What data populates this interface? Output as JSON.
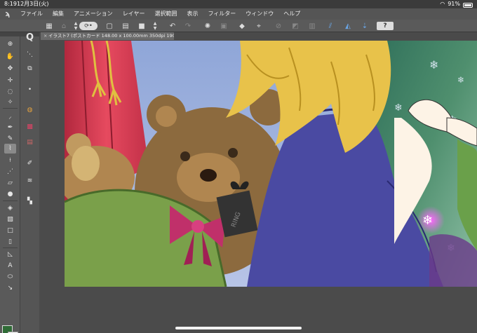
{
  "status_bar": {
    "time": "8:19",
    "date": "12月3日(火)",
    "battery": "91%"
  },
  "menu": {
    "items": [
      "ファイル",
      "編集",
      "アニメーション",
      "レイヤー",
      "選択範囲",
      "表示",
      "フィルター",
      "ウィンドウ",
      "ヘルプ"
    ]
  },
  "toolbar": {
    "help_label": "?",
    "zoom_icon": "zoom-icon"
  },
  "document": {
    "tab_title": "イラスト7 (ポストカード 148.00 x 100.00mm 350dpi 190.2%)"
  },
  "colors": {
    "foreground": "#2f6b36",
    "background": "#ffffff",
    "accent": "#6aa7e8"
  },
  "tools_left": [
    "magnifier-icon",
    "hand-icon",
    "move-icon",
    "transform-icon",
    "lasso-icon",
    "auto-select-icon",
    "eyedropper-icon",
    "pen-icon",
    "pencil-icon",
    "brush-icon",
    "airbrush-icon",
    "decoration-icon",
    "eraser-icon",
    "blend-icon",
    "fill-icon",
    "gradient-icon",
    "figure-icon",
    "frame-icon",
    "ruler-icon",
    "text-icon",
    "balloon-icon",
    "correction-icon"
  ],
  "tools_right": [
    "search-icon",
    "subtool-icon",
    "layer-icon",
    "brush-size-icon",
    "color-wheel-icon",
    "color-set-icon",
    "layer-property-icon",
    "navigator-icon",
    "stabilizer-icon",
    "material-icon"
  ]
}
